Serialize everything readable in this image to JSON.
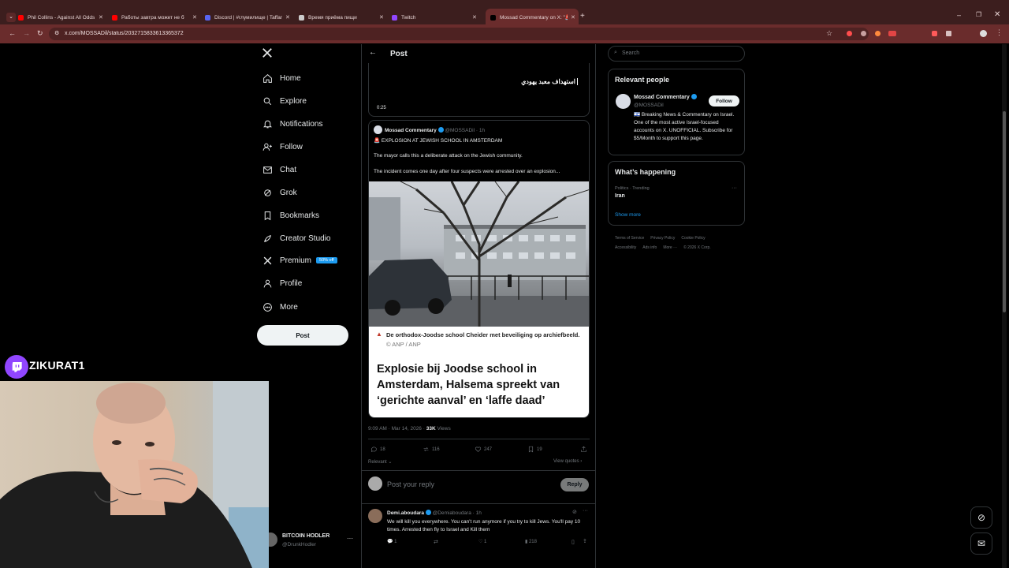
{
  "browser": {
    "tabs": [
      {
        "title": "Phil Collins - Against All Odds (",
        "color": "#ff0000"
      },
      {
        "title": "Работы завтра может не б",
        "color": "#ff0000"
      },
      {
        "title": "Discord | #глумилище | Taffam",
        "color": "#5865f2"
      },
      {
        "title": "Время приёма пищи",
        "color": "#cccccc"
      },
      {
        "title": "Twitch",
        "color": "#9146ff"
      },
      {
        "title": "Mossad Commentary on X: \"🚨",
        "color": "#000000"
      }
    ],
    "url": "x.com/MOSSADil/status/2032715833613365372"
  },
  "sidebar": {
    "items": [
      {
        "label": "Home",
        "icon": "home-icon"
      },
      {
        "label": "Explore",
        "icon": "search-icon"
      },
      {
        "label": "Notifications",
        "icon": "bell-icon"
      },
      {
        "label": "Follow",
        "icon": "add-person-icon"
      },
      {
        "label": "Chat",
        "icon": "mail-icon"
      },
      {
        "label": "Grok",
        "icon": "grok-icon"
      },
      {
        "label": "Bookmarks",
        "icon": "bookmark-icon"
      },
      {
        "label": "Creator Studio",
        "icon": "rocket-icon"
      },
      {
        "label": "Premium",
        "icon": "x-logo-icon"
      },
      {
        "label": "Profile",
        "icon": "person-icon"
      },
      {
        "label": "More",
        "icon": "more-circle-icon"
      }
    ],
    "premium_badge": "50% off",
    "post_button": "Post",
    "account_name": "BITCOIN HODLER",
    "account_handle": "@DrunkHodler"
  },
  "header": {
    "title": "Post"
  },
  "video": {
    "overlay_text": "استهداف معبد يهودي",
    "time": "0:25"
  },
  "quoted": {
    "author": "Mossad Commentary",
    "handle": "@MOSSADil",
    "age": "· 1h",
    "line1": "🚨 EXPLOSION AT JEWISH SCHOOL IN AMSTERDAM",
    "line2": "The mayor calls this a deliberate attack on the Jewish community.",
    "line3": "The incident comes one day after four suspects were arrested over an explosion...",
    "caption": "De orthodox-Joodse school Cheider met beveiliging op archiefbeeld.",
    "credit": "© ANP / ANP",
    "headline": "Explosie bij Joodse school in Amsterdam, Halsema spreekt van ‘gerichte aanval’ en ‘laffe daad’"
  },
  "meta": {
    "timestamp": "9:09 AM · Mar 14, 2026 ·",
    "views_count": "33K",
    "views_label": "Views"
  },
  "actions": {
    "replies": "18",
    "reposts": "116",
    "likes": "247",
    "bookmarks": "19"
  },
  "sort": {
    "label": "Relevant",
    "view_quotes": "View quotes"
  },
  "reply_box": {
    "placeholder": "Post your reply",
    "button": "Reply"
  },
  "reply": {
    "author": "Demi.aboudara",
    "handle": "@Demiaboudara",
    "age": "· 1h",
    "text": "We will kill you everywhere. You can't run anymore if you try to kill Jews. You'll pay 10 times. Arrested then fly to Israel and Kill them",
    "replies": "1",
    "likes": "1",
    "views": "218"
  },
  "right": {
    "search_placeholder": "Search",
    "relevant_title": "Relevant people",
    "person_name": "Mossad Commentary",
    "person_handle": "@MOSSADil",
    "follow": "Follow",
    "bio": "🇮🇱 Breaking News & Commentary on Israel. One of the most active Israel-focused accounts on X. UNOFFICIAL. Subscribe for $5/Month to support this page.",
    "happening_title": "What’s happening",
    "trend_context": "Politics · Trending",
    "trend_name": "Iran",
    "show_more": "Show more",
    "footer_links": [
      "Terms of Service",
      "Privacy Policy",
      "Cookie Policy",
      "Accessibility",
      "Ads info",
      "More ···",
      "© 2026 X Corp."
    ]
  },
  "stream": {
    "channel": "ZIKURAT1"
  }
}
